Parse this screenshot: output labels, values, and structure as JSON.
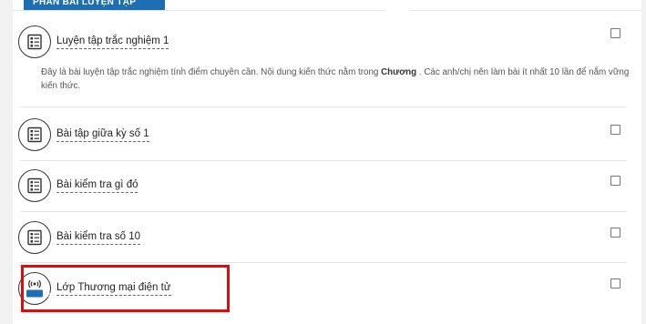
{
  "header": {
    "section_label": "PHẦN BÀI LUYỆN TẬP"
  },
  "activities": [
    {
      "name": "Luyện tập trắc nghiệm 1",
      "icon": "quiz-icon"
    },
    {
      "name": "Bài tập giữa kỳ số 1",
      "icon": "quiz-icon"
    },
    {
      "name": "Bài kiểm tra gì đó",
      "icon": "quiz-icon"
    },
    {
      "name": "Bài kiểm tra số 10",
      "icon": "quiz-icon"
    },
    {
      "name": "Lớp Thương mại điện tử",
      "icon": "live-class-icon",
      "badge": "LIVE"
    }
  ],
  "description": {
    "part1": "Đây là bài luyện tập trắc nghiệm tính điểm chuyên cần. Nội dung kiến thức nằm trong ",
    "bold": "Chương",
    "part2": " . Các anh/chị nên làm bài ít nhất 10 lần để nắm vững kiến thức."
  },
  "colors": {
    "header": "#1d6fb5",
    "highlight": "#e10b0b"
  }
}
